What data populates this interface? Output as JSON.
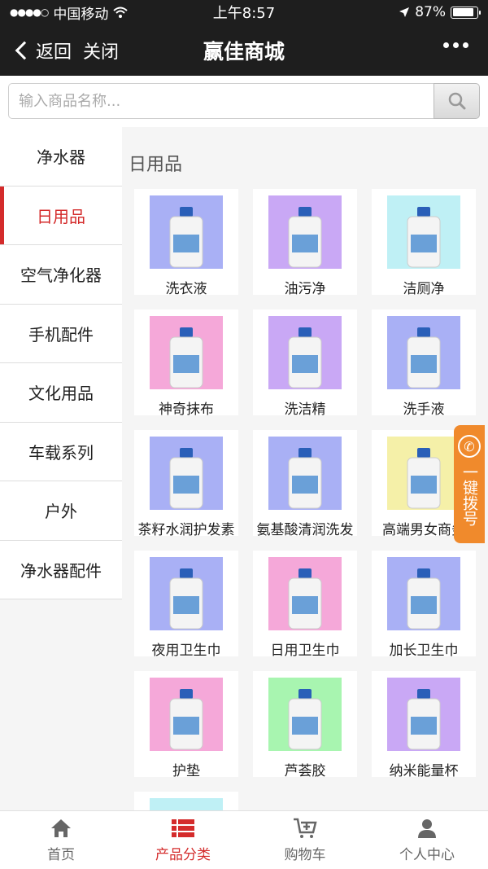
{
  "status": {
    "carrier": "中国移动",
    "time": "上午8:57",
    "battery": "87%",
    "battery_level": 0.87
  },
  "nav": {
    "back": "返回",
    "close": "关闭",
    "title": "赢佳商城"
  },
  "search": {
    "placeholder": "输入商品名称..."
  },
  "sidebar": {
    "items": [
      {
        "label": "净水器"
      },
      {
        "label": "日用品"
      },
      {
        "label": "空气净化器"
      },
      {
        "label": "手机配件"
      },
      {
        "label": "文化用品"
      },
      {
        "label": "车载系列"
      },
      {
        "label": "户外"
      },
      {
        "label": "净水器配件"
      }
    ]
  },
  "content": {
    "title": "日用品",
    "products": [
      {
        "name": "洗衣液",
        "bg": "#a9b0f5"
      },
      {
        "name": "油污净",
        "bg": "#c9a8f5"
      },
      {
        "name": "洁厕净",
        "bg": "#bff0f5"
      },
      {
        "name": "神奇抹布",
        "bg": "#f5a8d9"
      },
      {
        "name": "洗洁精",
        "bg": "#c9a8f5"
      },
      {
        "name": "洗手液",
        "bg": "#a9b0f5"
      },
      {
        "name": "茶籽水润护发素",
        "bg": "#a9b0f5"
      },
      {
        "name": "氨基酸清润洗发",
        "bg": "#a9b0f5"
      },
      {
        "name": "高端男女商务",
        "bg": "#f5f0a8"
      },
      {
        "name": "夜用卫生巾",
        "bg": "#a9b0f5"
      },
      {
        "name": "日用卫生巾",
        "bg": "#f5a8d9"
      },
      {
        "name": "加长卫生巾",
        "bg": "#a9b0f5"
      },
      {
        "name": "护垫",
        "bg": "#f5a8d9"
      },
      {
        "name": "芦荟胶",
        "bg": "#a8f5b0"
      },
      {
        "name": "纳米能量杯",
        "bg": "#c9a8f5"
      }
    ]
  },
  "float_call": {
    "text": "一键拨号"
  },
  "tabs": [
    {
      "label": "首页",
      "icon": "home-icon"
    },
    {
      "label": "产品分类",
      "icon": "list-icon"
    },
    {
      "label": "购物车",
      "icon": "cart-icon"
    },
    {
      "label": "个人中心",
      "icon": "user-icon"
    }
  ]
}
